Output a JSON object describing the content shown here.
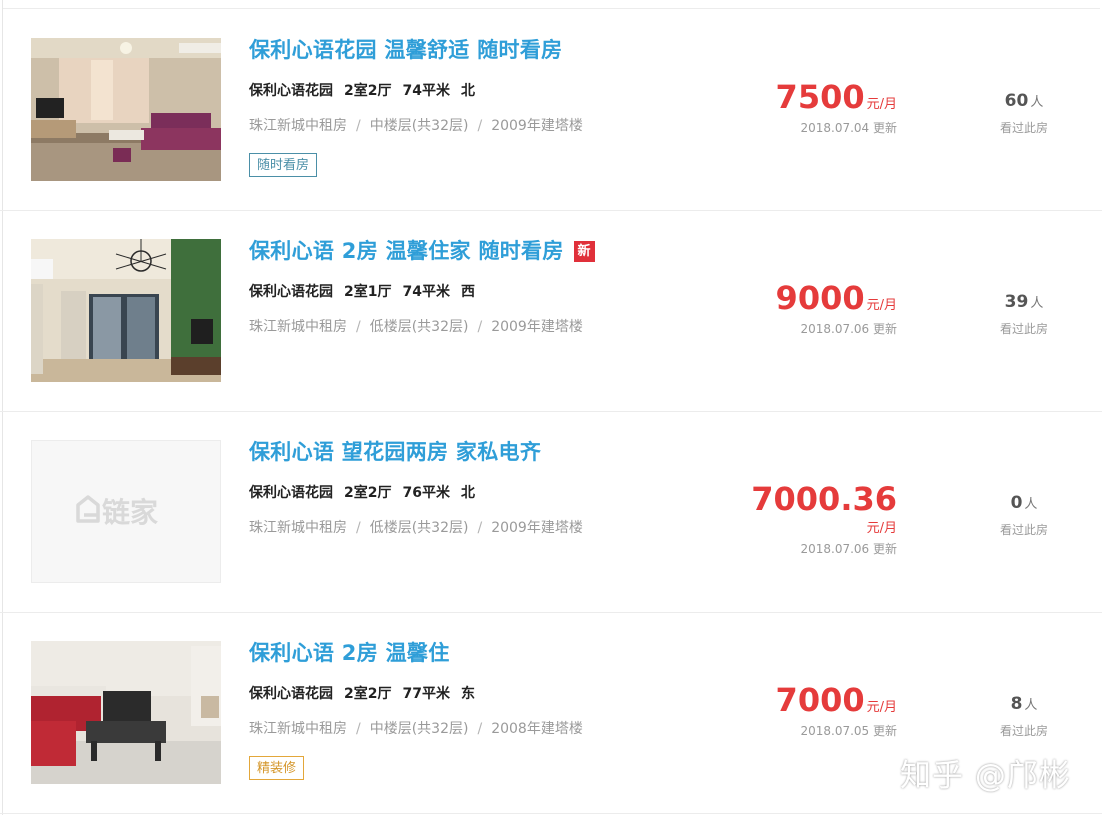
{
  "listings": [
    {
      "title": "保利心语花园 温馨舒适 随时看房",
      "is_new": false,
      "community": "保利心语花园",
      "layout": "2室2厅",
      "area": "74平米",
      "orientation": "北",
      "district": "珠江新城中租房",
      "floor": "中楼层(共32层)",
      "build_year": "2009年建塔楼",
      "tag": "随时看房",
      "price": "7500",
      "price_unit": "元/月",
      "update": "2018.07.04 更新",
      "views": "60",
      "views_unit": "人",
      "views_label": "看过此房",
      "image": "living-room-photo"
    },
    {
      "title": "保利心语 2房 温馨住家 随时看房",
      "is_new": true,
      "new_label": "新",
      "community": "保利心语花园",
      "layout": "2室1厅",
      "area": "74平米",
      "orientation": "西",
      "district": "珠江新城中租房",
      "floor": "低楼层(共32层)",
      "build_year": "2009年建塔楼",
      "tag": "",
      "price": "9000",
      "price_unit": "元/月",
      "update": "2018.07.06 更新",
      "views": "39",
      "views_unit": "人",
      "views_label": "看过此房",
      "image": "living-room-photo"
    },
    {
      "title": "保利心语 望花园两房 家私电齐",
      "is_new": false,
      "community": "保利心语花园",
      "layout": "2室2厅",
      "area": "76平米",
      "orientation": "北",
      "district": "珠江新城中租房",
      "floor": "低楼层(共32层)",
      "build_year": "2009年建塔楼",
      "tag": "",
      "price": "7000.36",
      "price_unit": "元/月",
      "update": "2018.07.06 更新",
      "views": "0",
      "views_unit": "人",
      "views_label": "看过此房",
      "image": "lianjia-placeholder",
      "placeholder_logo": "链家"
    },
    {
      "title": "保利心语 2房 温馨住",
      "is_new": false,
      "community": "保利心语花园",
      "layout": "2室2厅",
      "area": "77平米",
      "orientation": "东",
      "district": "珠江新城中租房",
      "floor": "中楼层(共32层)",
      "build_year": "2008年建塔楼",
      "tag": "精装修",
      "price": "7000",
      "price_unit": "元/月",
      "update": "2018.07.05 更新",
      "views": "8",
      "views_unit": "人",
      "views_label": "看过此房",
      "image": "living-room-photo"
    }
  ],
  "watermark": "知乎 @邝彬",
  "colors": {
    "title": "#2f9ed8",
    "price": "#e53b3b",
    "new_badge": "#e0303a",
    "tag_blue": "#4b8fa7",
    "tag_gold": "#e3a73a"
  }
}
